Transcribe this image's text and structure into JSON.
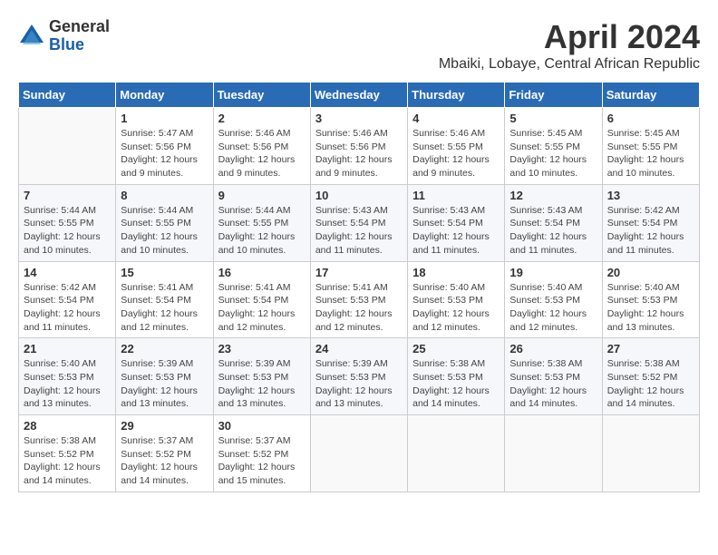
{
  "logo": {
    "general": "General",
    "blue": "Blue"
  },
  "title": "April 2024",
  "location": "Mbaiki, Lobaye, Central African Republic",
  "days_of_week": [
    "Sunday",
    "Monday",
    "Tuesday",
    "Wednesday",
    "Thursday",
    "Friday",
    "Saturday"
  ],
  "weeks": [
    [
      {
        "day": "",
        "info": ""
      },
      {
        "day": "1",
        "info": "Sunrise: 5:47 AM\nSunset: 5:56 PM\nDaylight: 12 hours\nand 9 minutes."
      },
      {
        "day": "2",
        "info": "Sunrise: 5:46 AM\nSunset: 5:56 PM\nDaylight: 12 hours\nand 9 minutes."
      },
      {
        "day": "3",
        "info": "Sunrise: 5:46 AM\nSunset: 5:56 PM\nDaylight: 12 hours\nand 9 minutes."
      },
      {
        "day": "4",
        "info": "Sunrise: 5:46 AM\nSunset: 5:55 PM\nDaylight: 12 hours\nand 9 minutes."
      },
      {
        "day": "5",
        "info": "Sunrise: 5:45 AM\nSunset: 5:55 PM\nDaylight: 12 hours\nand 10 minutes."
      },
      {
        "day": "6",
        "info": "Sunrise: 5:45 AM\nSunset: 5:55 PM\nDaylight: 12 hours\nand 10 minutes."
      }
    ],
    [
      {
        "day": "7",
        "info": "Sunrise: 5:44 AM\nSunset: 5:55 PM\nDaylight: 12 hours\nand 10 minutes."
      },
      {
        "day": "8",
        "info": "Sunrise: 5:44 AM\nSunset: 5:55 PM\nDaylight: 12 hours\nand 10 minutes."
      },
      {
        "day": "9",
        "info": "Sunrise: 5:44 AM\nSunset: 5:55 PM\nDaylight: 12 hours\nand 10 minutes."
      },
      {
        "day": "10",
        "info": "Sunrise: 5:43 AM\nSunset: 5:54 PM\nDaylight: 12 hours\nand 11 minutes."
      },
      {
        "day": "11",
        "info": "Sunrise: 5:43 AM\nSunset: 5:54 PM\nDaylight: 12 hours\nand 11 minutes."
      },
      {
        "day": "12",
        "info": "Sunrise: 5:43 AM\nSunset: 5:54 PM\nDaylight: 12 hours\nand 11 minutes."
      },
      {
        "day": "13",
        "info": "Sunrise: 5:42 AM\nSunset: 5:54 PM\nDaylight: 12 hours\nand 11 minutes."
      }
    ],
    [
      {
        "day": "14",
        "info": "Sunrise: 5:42 AM\nSunset: 5:54 PM\nDaylight: 12 hours\nand 11 minutes."
      },
      {
        "day": "15",
        "info": "Sunrise: 5:41 AM\nSunset: 5:54 PM\nDaylight: 12 hours\nand 12 minutes."
      },
      {
        "day": "16",
        "info": "Sunrise: 5:41 AM\nSunset: 5:54 PM\nDaylight: 12 hours\nand 12 minutes."
      },
      {
        "day": "17",
        "info": "Sunrise: 5:41 AM\nSunset: 5:53 PM\nDaylight: 12 hours\nand 12 minutes."
      },
      {
        "day": "18",
        "info": "Sunrise: 5:40 AM\nSunset: 5:53 PM\nDaylight: 12 hours\nand 12 minutes."
      },
      {
        "day": "19",
        "info": "Sunrise: 5:40 AM\nSunset: 5:53 PM\nDaylight: 12 hours\nand 12 minutes."
      },
      {
        "day": "20",
        "info": "Sunrise: 5:40 AM\nSunset: 5:53 PM\nDaylight: 12 hours\nand 13 minutes."
      }
    ],
    [
      {
        "day": "21",
        "info": "Sunrise: 5:40 AM\nSunset: 5:53 PM\nDaylight: 12 hours\nand 13 minutes."
      },
      {
        "day": "22",
        "info": "Sunrise: 5:39 AM\nSunset: 5:53 PM\nDaylight: 12 hours\nand 13 minutes."
      },
      {
        "day": "23",
        "info": "Sunrise: 5:39 AM\nSunset: 5:53 PM\nDaylight: 12 hours\nand 13 minutes."
      },
      {
        "day": "24",
        "info": "Sunrise: 5:39 AM\nSunset: 5:53 PM\nDaylight: 12 hours\nand 13 minutes."
      },
      {
        "day": "25",
        "info": "Sunrise: 5:38 AM\nSunset: 5:53 PM\nDaylight: 12 hours\nand 14 minutes."
      },
      {
        "day": "26",
        "info": "Sunrise: 5:38 AM\nSunset: 5:53 PM\nDaylight: 12 hours\nand 14 minutes."
      },
      {
        "day": "27",
        "info": "Sunrise: 5:38 AM\nSunset: 5:52 PM\nDaylight: 12 hours\nand 14 minutes."
      }
    ],
    [
      {
        "day": "28",
        "info": "Sunrise: 5:38 AM\nSunset: 5:52 PM\nDaylight: 12 hours\nand 14 minutes."
      },
      {
        "day": "29",
        "info": "Sunrise: 5:37 AM\nSunset: 5:52 PM\nDaylight: 12 hours\nand 14 minutes."
      },
      {
        "day": "30",
        "info": "Sunrise: 5:37 AM\nSunset: 5:52 PM\nDaylight: 12 hours\nand 15 minutes."
      },
      {
        "day": "",
        "info": ""
      },
      {
        "day": "",
        "info": ""
      },
      {
        "day": "",
        "info": ""
      },
      {
        "day": "",
        "info": ""
      }
    ]
  ]
}
